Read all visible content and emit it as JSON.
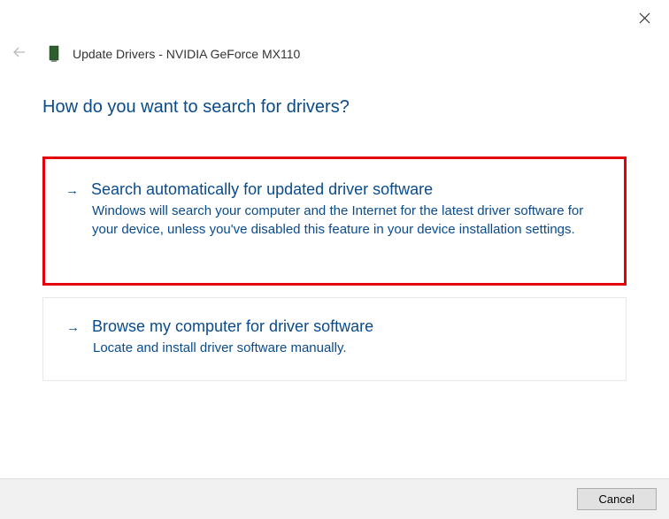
{
  "header": {
    "title": "Update Drivers - NVIDIA GeForce MX110"
  },
  "main": {
    "heading": "How do you want to search for drivers?"
  },
  "options": [
    {
      "title": "Search automatically for updated driver software",
      "description": "Windows will search your computer and the Internet for the latest driver software for your device, unless you've disabled this feature in your device installation settings."
    },
    {
      "title": "Browse my computer for driver software",
      "description": "Locate and install driver software manually."
    }
  ],
  "footer": {
    "cancel_label": "Cancel"
  }
}
